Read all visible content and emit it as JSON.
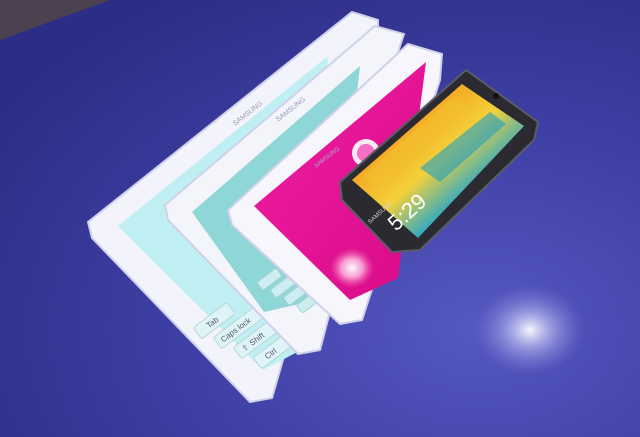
{
  "scene": {
    "colors": {
      "table": "#3d3fa3",
      "table_shadow": "#2b2c7c",
      "tablet_bezel": "#e9e9f6",
      "screen_cyan": "#bdeff1",
      "screen_teal": "#8fd6d6",
      "screen_magenta": "#e8139a",
      "phone_body": "#26262c"
    }
  },
  "tablet_large": {
    "brand": "SAMSUNG",
    "keys": [
      "Tab",
      "Caps lock",
      "Shift",
      "Ctrl"
    ],
    "key_icon": "shift-arrow-icon"
  },
  "tablet_medium": {
    "brand": "SAMSUNG"
  },
  "tablet_small": {
    "brand": "SAMSUNG"
  },
  "phone": {
    "brand": "SAMSUNG",
    "clock": "5:29"
  }
}
